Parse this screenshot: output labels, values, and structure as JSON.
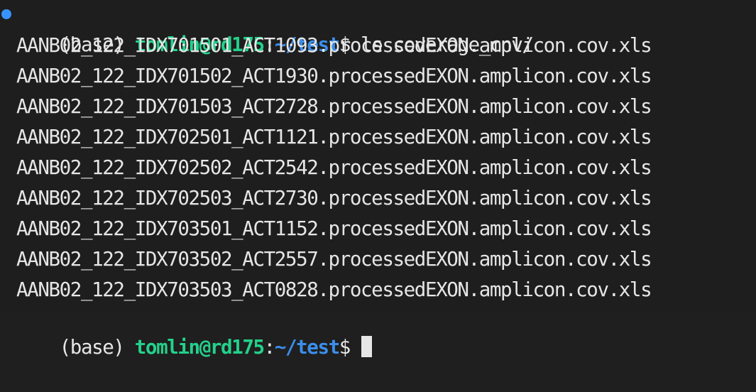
{
  "prompt": {
    "env": "(base) ",
    "user_host": "tomlin@rd175",
    "colon": ":",
    "path": "~/test",
    "symbol": "$",
    "command": " ls coverage_cnv/"
  },
  "output_files": [
    "AANB02_122_IDX701501_ACT1093.processedEXON.amplicon.cov.xls",
    "AANB02_122_IDX701502_ACT1930.processedEXON.amplicon.cov.xls",
    "AANB02_122_IDX701503_ACT2728.processedEXON.amplicon.cov.xls",
    "AANB02_122_IDX702501_ACT1121.processedEXON.amplicon.cov.xls",
    "AANB02_122_IDX702502_ACT2542.processedEXON.amplicon.cov.xls",
    "AANB02_122_IDX702503_ACT2730.processedEXON.amplicon.cov.xls",
    "AANB02_122_IDX703501_ACT1152.processedEXON.amplicon.cov.xls",
    "AANB02_122_IDX703502_ACT2557.processedEXON.amplicon.cov.xls",
    "AANB02_122_IDX703503_ACT0828.processedEXON.amplicon.cov.xls"
  ],
  "next_prompt": {
    "env": "(base) ",
    "user_host": "tomlin@rd175",
    "colon": ":",
    "path": "~/test",
    "symbol": "$"
  },
  "colors": {
    "background": "#1e1e1e",
    "user_host": "#23d18b",
    "path": "#3b8eea",
    "text": "#e6e6e6",
    "prompt_dot": "#3794ff"
  }
}
